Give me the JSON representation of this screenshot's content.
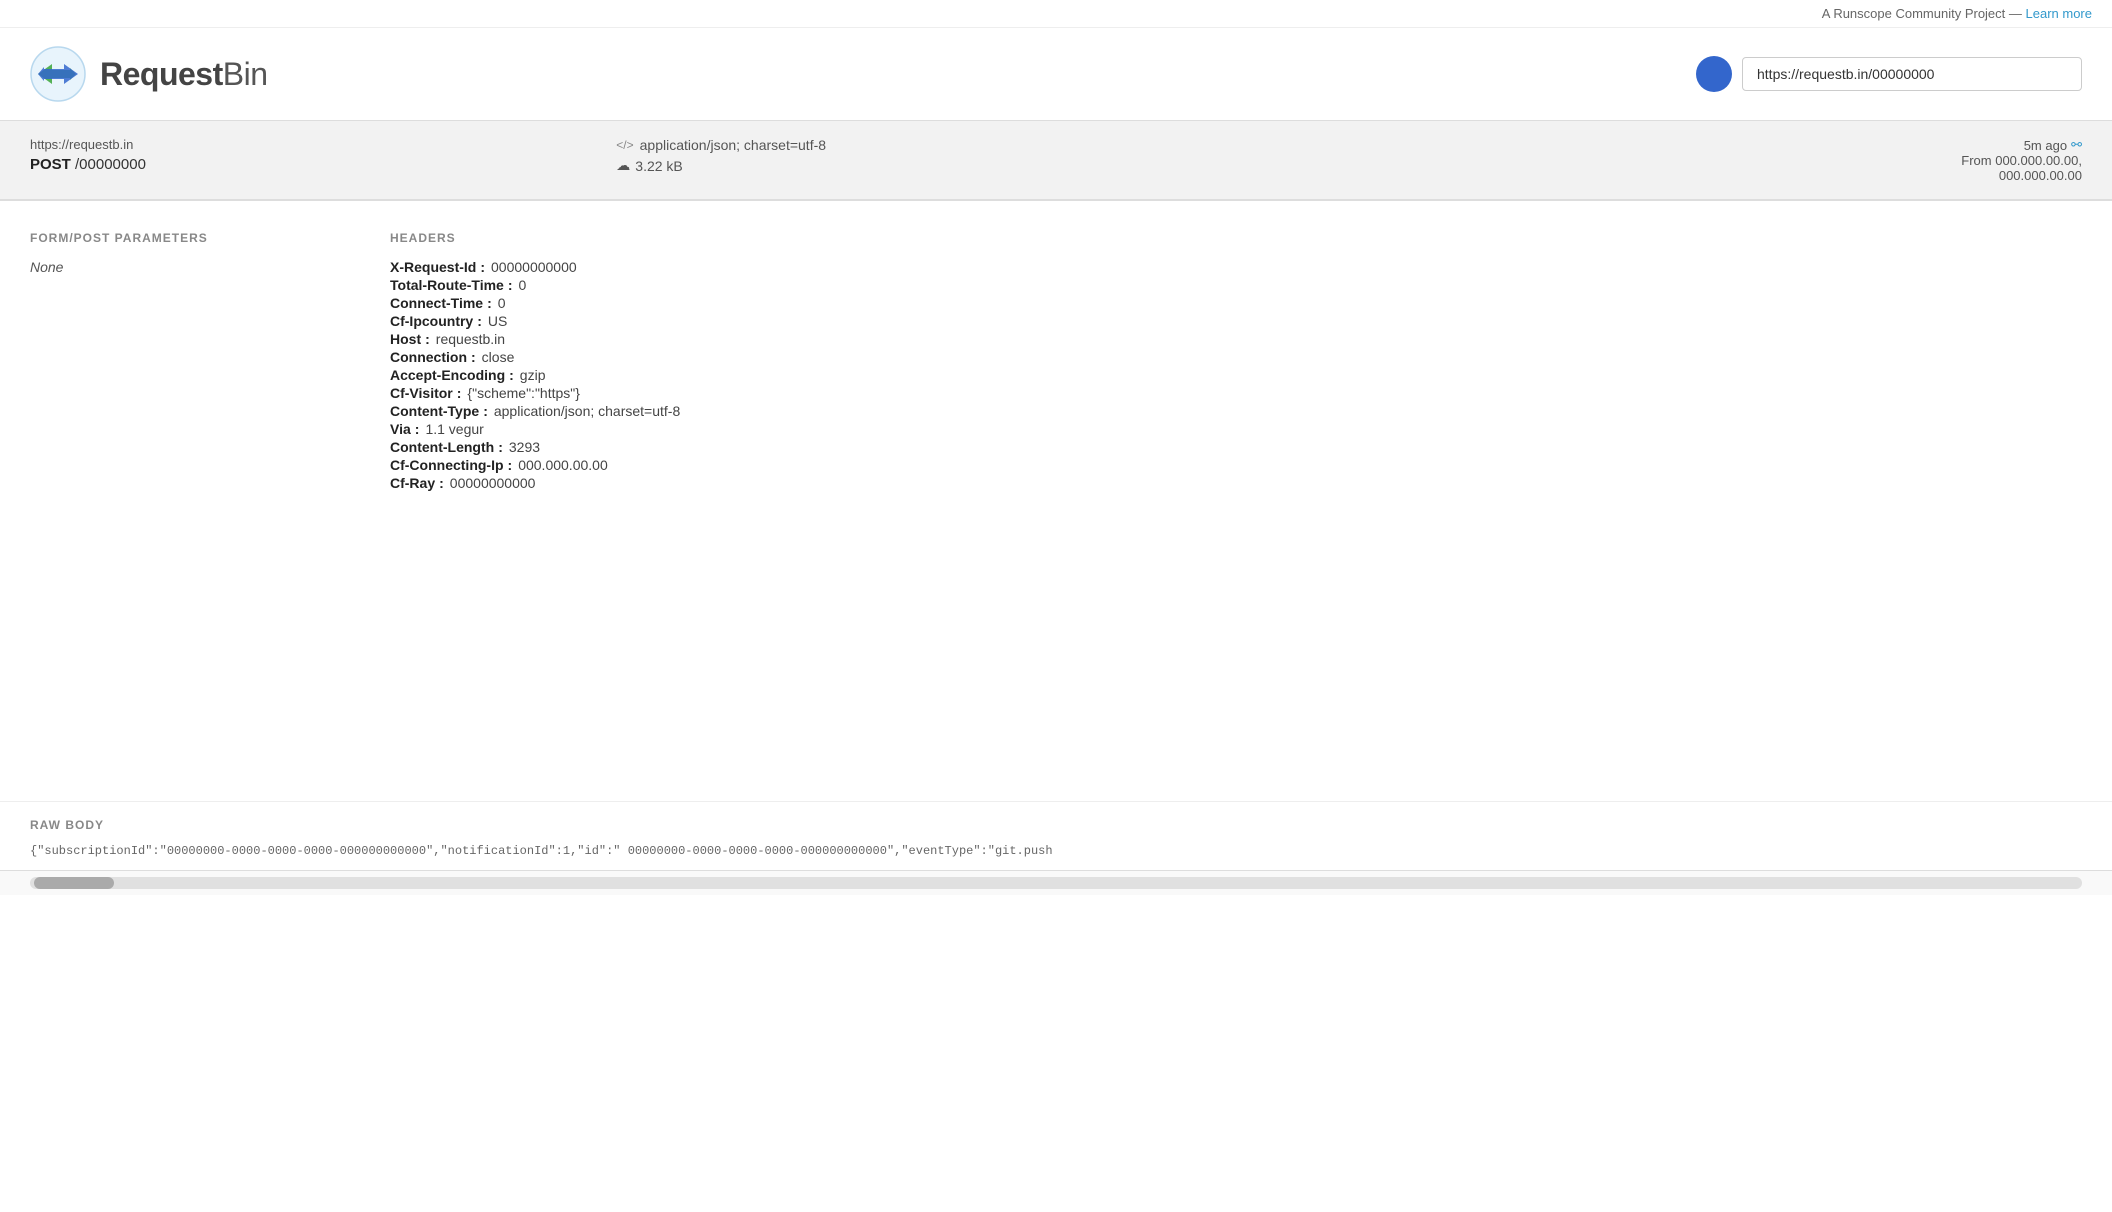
{
  "topbar": {
    "community_text": "A Runscope Community Project —",
    "learn_more_label": "Learn more",
    "learn_more_url": "#"
  },
  "header": {
    "logo_text_bold": "Request",
    "logo_text_light": "Bin",
    "url_value": "https://requestb.in/00000000"
  },
  "request_bar": {
    "url": "https://requestb.in",
    "method": "POST",
    "path": "/00000000",
    "content_type_icon": "</>",
    "content_type": "application/json; charset=utf-8",
    "size_icon": "☁",
    "size": "3.22 kB",
    "time": "5m ago",
    "link_icon": "⚯",
    "from_label": "From 000.000.00.00,",
    "from_label2": "000.000.00.00"
  },
  "form_post": {
    "title": "FORM/POST PARAMETERS",
    "value": "None"
  },
  "headers": {
    "title": "HEADERS",
    "items": [
      {
        "key": "X-Request-Id",
        "value": "00000000000"
      },
      {
        "key": "Total-Route-Time",
        "value": "0"
      },
      {
        "key": "Connect-Time",
        "value": "0"
      },
      {
        "key": "Cf-Ipcountry",
        "value": "US"
      },
      {
        "key": "Host",
        "value": "requestb.in"
      },
      {
        "key": "Connection",
        "value": "close"
      },
      {
        "key": "Accept-Encoding",
        "value": "gzip"
      },
      {
        "key": "Cf-Visitor",
        "value": "{\"scheme\":\"https\"}"
      },
      {
        "key": "Content-Type",
        "value": "application/json; charset=utf-8"
      },
      {
        "key": "Via",
        "value": "1.1 vegur"
      },
      {
        "key": "Content-Length",
        "value": "3293"
      },
      {
        "key": "Cf-Connecting-Ip",
        "value": "000.000.00.00"
      },
      {
        "key": "Cf-Ray",
        "value": "00000000000"
      }
    ]
  },
  "raw_body": {
    "title": "RAW BODY",
    "content": "{\"subscriptionId\":\"00000000-0000-0000-0000-000000000000\",\"notificationId\":1,\"id\":\" 00000000-0000-0000-0000-000000000000\",\"eventType\":\"git.push"
  },
  "colors": {
    "accent_blue": "#3366cc",
    "link_blue": "#3399cc",
    "header_bg": "#f2f2f2"
  }
}
